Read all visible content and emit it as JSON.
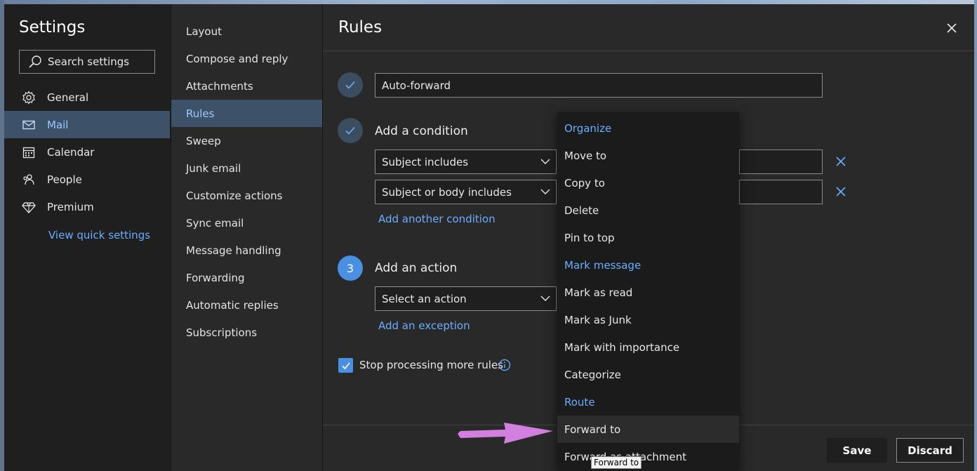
{
  "settings": {
    "title": "Settings",
    "search_placeholder": "Search settings",
    "nav": [
      {
        "label": "General",
        "icon": "gear-icon"
      },
      {
        "label": "Mail",
        "icon": "mail-icon",
        "active": true
      },
      {
        "label": "Calendar",
        "icon": "calendar-icon"
      },
      {
        "label": "People",
        "icon": "people-icon"
      },
      {
        "label": "Premium",
        "icon": "diamond-icon"
      }
    ],
    "quick_settings_link": "View quick settings"
  },
  "mail_sections": [
    "Layout",
    "Compose and reply",
    "Attachments",
    "Rules",
    "Sweep",
    "Junk email",
    "Customize actions",
    "Sync email",
    "Message handling",
    "Forwarding",
    "Automatic replies",
    "Subscriptions"
  ],
  "rules": {
    "title": "Rules",
    "rule_name": "Auto-forward",
    "condition_heading": "Add a condition",
    "conditions": [
      "Subject includes",
      "Subject or body includes"
    ],
    "add_condition_link": "Add another condition",
    "action_step": "3",
    "action_heading": "Add an action",
    "action_select": "Select an action",
    "add_exception_link": "Add an exception",
    "stop_processing_label": "Stop processing more rules",
    "save_label": "Save",
    "discard_label": "Discard"
  },
  "action_menu": {
    "items": [
      {
        "label": "Organize",
        "type": "header"
      },
      {
        "label": "Move to",
        "type": "item"
      },
      {
        "label": "Copy to",
        "type": "item"
      },
      {
        "label": "Delete",
        "type": "item"
      },
      {
        "label": "Pin to top",
        "type": "item"
      },
      {
        "label": "Mark message",
        "type": "header"
      },
      {
        "label": "Mark as read",
        "type": "item"
      },
      {
        "label": "Mark as Junk",
        "type": "item"
      },
      {
        "label": "Mark with importance",
        "type": "item"
      },
      {
        "label": "Categorize",
        "type": "item"
      },
      {
        "label": "Route",
        "type": "header"
      },
      {
        "label": "Forward to",
        "type": "item",
        "hover": true
      },
      {
        "label": "Forward as attachment",
        "type": "item"
      }
    ],
    "tooltip": "Forward to"
  },
  "colors": {
    "accent": "#6aaeff",
    "active_bg": "#3d5269",
    "annotation_arrow": "#d37fe0"
  }
}
